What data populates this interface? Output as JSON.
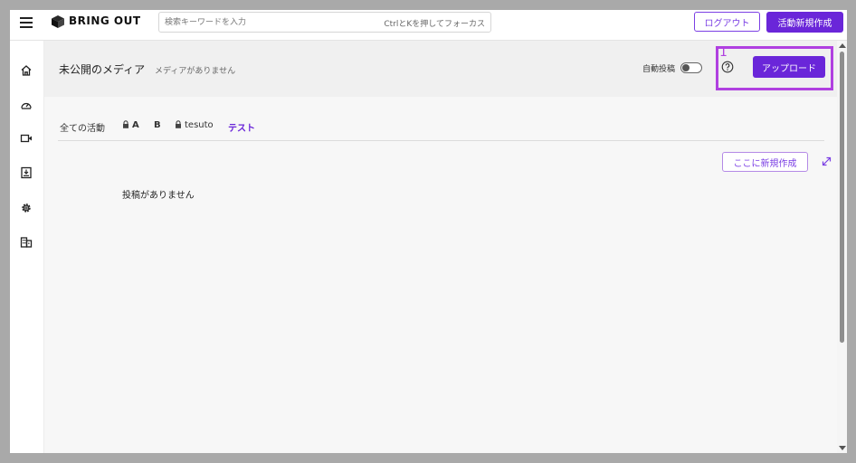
{
  "brand": {
    "name": "BRING OUT"
  },
  "search": {
    "placeholder": "検索キーワードを入力",
    "shortcut_hint": "CtrlとKを押してフォーカス"
  },
  "topbar": {
    "logout_label": "ログアウト",
    "new_activity_label": "活動新規作成"
  },
  "sidebar": {
    "items": [
      {
        "icon": "home-icon"
      },
      {
        "icon": "dashboard-gauge-icon"
      },
      {
        "icon": "video-camera-icon"
      },
      {
        "icon": "download-tray-icon"
      },
      {
        "icon": "gear-icon"
      },
      {
        "icon": "building-icon"
      }
    ]
  },
  "header": {
    "title": "未公開のメディア",
    "subtitle": "メディアがありません",
    "auto_post_label": "自動投稿",
    "auto_post_enabled": false,
    "upload_label": "アップロード",
    "annotation_number": "1"
  },
  "tabs": [
    {
      "label": "全ての活動",
      "locked": false,
      "active": false
    },
    {
      "label": "A",
      "locked": true,
      "active": false
    },
    {
      "label": "B",
      "locked": false,
      "active": false
    },
    {
      "label": "tesuto",
      "locked": true,
      "active": false
    },
    {
      "label": "テスト",
      "locked": false,
      "active": true
    }
  ],
  "content": {
    "create_here_label": "ここに新規作成",
    "empty_message": "投稿がありません"
  },
  "colors": {
    "accent": "#6a26d9",
    "annotation": "#b040e0",
    "outline_accent": "#7b3fe4"
  }
}
